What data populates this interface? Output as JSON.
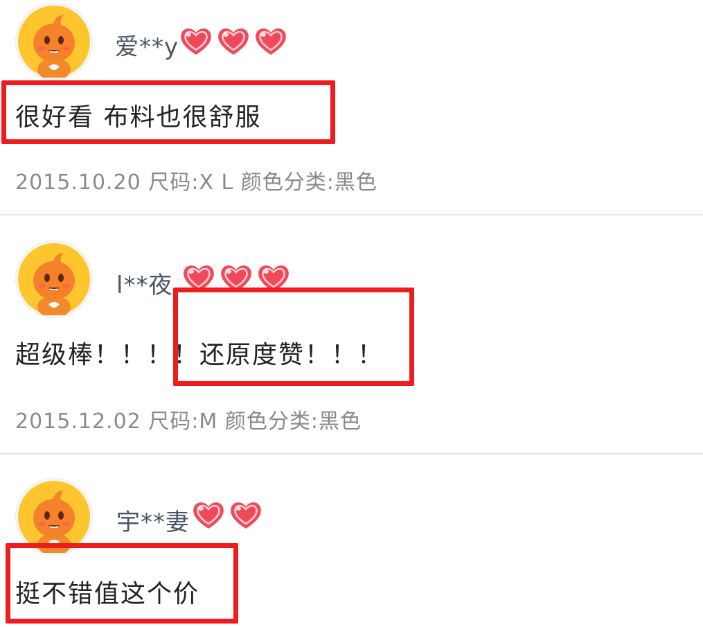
{
  "reviews": [
    {
      "username": "爱**y",
      "hearts": 3,
      "text": "很好看 布料也很舒服",
      "meta": "2015.10.20 尺码:X L  颜色分类:黑色",
      "avatar": "orange-mascot-avatar"
    },
    {
      "username": "l**夜",
      "hearts": 3,
      "text": "超级棒！！！！还原度赞！！！",
      "meta": "2015.12.02 尺码:M  颜色分类:黑色",
      "avatar": "orange-mascot-avatar"
    },
    {
      "username": "宇**妻",
      "hearts": 2,
      "text": "挺不错值这个价",
      "avatar": "orange-mascot-avatar"
    }
  ],
  "colors": {
    "highlight": "#ee1c1c",
    "heart": "#f04a5a",
    "username": "#4a5566",
    "meta": "#8a8a8a",
    "divider": "#e6e6e6"
  }
}
